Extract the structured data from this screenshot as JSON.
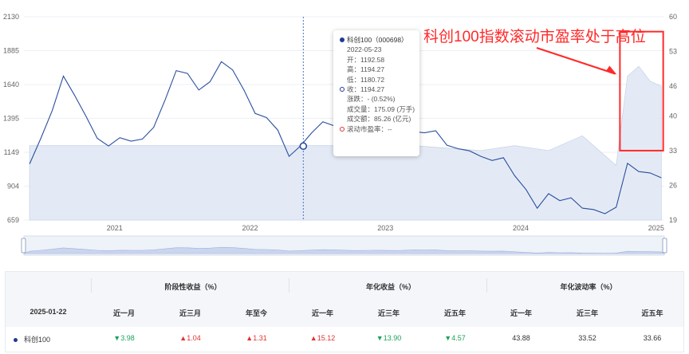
{
  "chart_data": {
    "type": "line",
    "title": "",
    "x_ticks": [
      "2021",
      "2022",
      "2023",
      "2024",
      "2025"
    ],
    "y_left_ticks": [
      659,
      904,
      1149,
      1395,
      1640,
      1885,
      2130
    ],
    "y_left_range": [
      659,
      2130
    ],
    "y_right_ticks": [
      19,
      26,
      33,
      40,
      46,
      53,
      60
    ],
    "y_right_range": [
      19,
      60
    ],
    "grid": true,
    "series": [
      {
        "name": "科创100",
        "axis": "left",
        "points": [
          [
            "2020-05",
            1065
          ],
          [
            "2020-06",
            1250
          ],
          [
            "2020-07",
            1450
          ],
          [
            "2020-08",
            1700
          ],
          [
            "2020-09",
            1560
          ],
          [
            "2020-10",
            1410
          ],
          [
            "2020-11",
            1250
          ],
          [
            "2020-12",
            1195
          ],
          [
            "2021-01",
            1255
          ],
          [
            "2021-02",
            1230
          ],
          [
            "2021-03",
            1245
          ],
          [
            "2021-04",
            1330
          ],
          [
            "2021-05",
            1525
          ],
          [
            "2021-06",
            1740
          ],
          [
            "2021-07",
            1720
          ],
          [
            "2021-08",
            1600
          ],
          [
            "2021-09",
            1660
          ],
          [
            "2021-10",
            1805
          ],
          [
            "2021-11",
            1745
          ],
          [
            "2021-12",
            1600
          ],
          [
            "2022-01",
            1430
          ],
          [
            "2022-02",
            1400
          ],
          [
            "2022-03",
            1310
          ],
          [
            "2022-04",
            1120
          ],
          [
            "2022-05",
            1194
          ],
          [
            "2022-06",
            1290
          ],
          [
            "2022-07",
            1370
          ],
          [
            "2022-08",
            1340
          ],
          [
            "2022-09",
            1265
          ],
          [
            "2022-10",
            1210
          ],
          [
            "2022-11",
            1245
          ],
          [
            "2022-12",
            1255
          ],
          [
            "2023-01",
            1225
          ],
          [
            "2023-02",
            1240
          ],
          [
            "2023-03",
            1300
          ],
          [
            "2023-04",
            1290
          ],
          [
            "2023-05",
            1305
          ],
          [
            "2023-06",
            1200
          ],
          [
            "2023-07",
            1175
          ],
          [
            "2023-08",
            1160
          ],
          [
            "2023-09",
            1120
          ],
          [
            "2023-10",
            1090
          ],
          [
            "2023-11",
            1110
          ],
          [
            "2023-12",
            980
          ],
          [
            "2024-01",
            880
          ],
          [
            "2024-02",
            745
          ],
          [
            "2024-03",
            850
          ],
          [
            "2024-04",
            800
          ],
          [
            "2024-05",
            820
          ],
          [
            "2024-06",
            745
          ],
          [
            "2024-07",
            735
          ],
          [
            "2024-08",
            705
          ],
          [
            "2024-09",
            752
          ],
          [
            "2024-10",
            1070
          ],
          [
            "2024-11",
            1010
          ],
          [
            "2024-12",
            1000
          ],
          [
            "2025-01",
            965
          ]
        ]
      },
      {
        "name": "滚动市盈率",
        "axis": "right",
        "style": "area",
        "points": [
          [
            "2020-05",
            34
          ],
          [
            "2021-01",
            34
          ],
          [
            "2022-01",
            34
          ],
          [
            "2022-12",
            34
          ],
          [
            "2023-03",
            34
          ],
          [
            "2023-06",
            33.5
          ],
          [
            "2023-09",
            33
          ],
          [
            "2023-12",
            34
          ],
          [
            "2024-03",
            33
          ],
          [
            "2024-06",
            36
          ],
          [
            "2024-09",
            30
          ],
          [
            "2024-10",
            48
          ],
          [
            "2024-11",
            50
          ],
          [
            "2024-12",
            47
          ],
          [
            "2025-01",
            46
          ]
        ]
      }
    ]
  },
  "annotation": "科创100指数滚动市盈率处于高位",
  "tooltip": {
    "series": "科创100（000698）",
    "date": "2022-05-23",
    "open": "开：1192.58",
    "high": "高：1194.27",
    "low": "低：1180.72",
    "close": "收：1194.27",
    "change": "涨跌：- (0.52%)",
    "volume": "成交量：175.09 (万手)",
    "amount": "成交额：85.26 (亿元)",
    "pe": "滚动市盈率：--"
  },
  "colors": {
    "line": "#2a4f9e",
    "area": "#dfe6f3",
    "annotation": "#ff2a2a",
    "up": "#e0332f",
    "down": "#1ba25a"
  },
  "table": {
    "date": "2025-01-22",
    "groups": [
      "阶段性收益（%）",
      "年化收益（%）",
      "年化波动率（%）"
    ],
    "columns": [
      "近一月",
      "近三月",
      "年至今",
      "近一年",
      "近三年",
      "近五年",
      "近一年",
      "近三年",
      "近五年"
    ],
    "row": {
      "name": "科创100",
      "values": [
        {
          "text": "▼3.98",
          "dir": "down"
        },
        {
          "text": "▲1.04",
          "dir": "up"
        },
        {
          "text": "▲1.31",
          "dir": "up"
        },
        {
          "text": "▲15.12",
          "dir": "up"
        },
        {
          "text": "▼13.90",
          "dir": "down"
        },
        {
          "text": "▼4.57",
          "dir": "down"
        },
        {
          "text": "43.88",
          "dir": "plain"
        },
        {
          "text": "33.52",
          "dir": "plain"
        },
        {
          "text": "33.66",
          "dir": "plain"
        }
      ]
    }
  }
}
